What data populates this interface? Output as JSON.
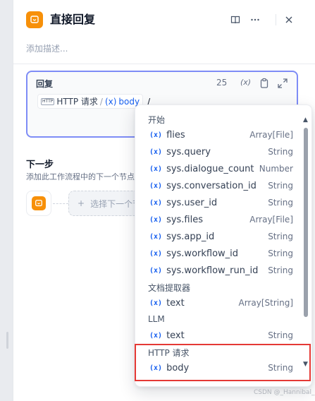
{
  "header": {
    "title": "直接回复",
    "description_placeholder": "添加描述..."
  },
  "editor": {
    "label": "回复",
    "char_count": "25",
    "var_button": "(x)",
    "content": {
      "node_tag": "HTTP",
      "node_name": "HTTP 请求",
      "separator": "/",
      "var_prefix": "(x)",
      "field": "body",
      "typed": "/"
    }
  },
  "next_step": {
    "title": "下一步",
    "description": "添加此工作流程中的下一个节点",
    "select_label": "选择下一个节点"
  },
  "dropdown": {
    "sections": [
      {
        "name": "开始",
        "items": [
          {
            "name": "flies",
            "type": "Array[File]"
          },
          {
            "name": "sys.query",
            "type": "String"
          },
          {
            "name": "sys.dialogue_count",
            "type": "Number"
          },
          {
            "name": "sys.conversation_id",
            "type": "String"
          },
          {
            "name": "sys.user_id",
            "type": "String"
          },
          {
            "name": "sys.files",
            "type": "Array[File]"
          },
          {
            "name": "sys.app_id",
            "type": "String"
          },
          {
            "name": "sys.workflow_id",
            "type": "String"
          },
          {
            "name": "sys.workflow_run_id",
            "type": "String"
          }
        ]
      },
      {
        "name": "文档提取器",
        "items": [
          {
            "name": "text",
            "type": "Array[String]"
          }
        ]
      },
      {
        "name": "LLM",
        "items": [
          {
            "name": "text",
            "type": "String"
          }
        ]
      },
      {
        "name": "HTTP 请求",
        "items": [
          {
            "name": "body",
            "type": "String"
          }
        ]
      }
    ],
    "var_prefix": "(x)"
  },
  "watermark": "CSDN @_Hannibal_",
  "colors": {
    "accent": "#155eef",
    "node_orange": "#f79009",
    "editor_border": "#7e8cf6",
    "highlight": "#e53935"
  }
}
